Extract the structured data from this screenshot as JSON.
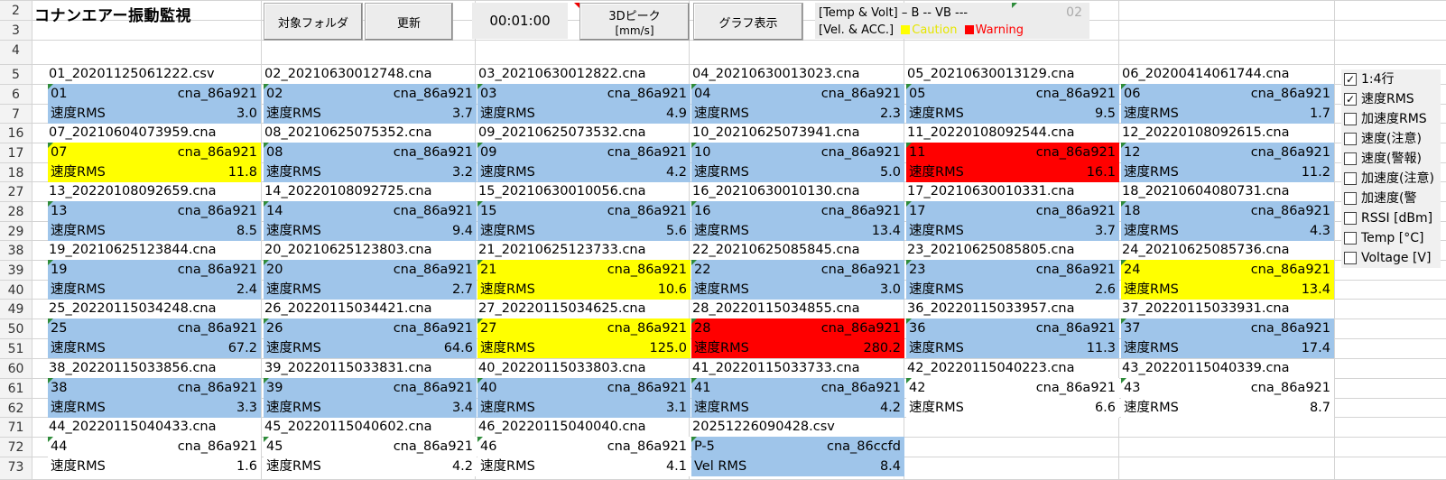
{
  "title": "コナンエアー振動監視",
  "row_numbers": [
    "2",
    "3",
    "4",
    "5",
    "6",
    "7",
    "16",
    "17",
    "18",
    "27",
    "28",
    "29",
    "38",
    "39",
    "40",
    "49",
    "50",
    "51",
    "60",
    "61",
    "62",
    "71",
    "72",
    "73"
  ],
  "toolbar": {
    "folder_button": "対象フォルダ",
    "refresh_button": "更新",
    "time": "00:01:00",
    "peak_button_line1": "3Dピーク",
    "peak_button_line2": "[mm/s]",
    "graph_button": "グラフ表示"
  },
  "legend": {
    "line1": "[Temp & Volt] – B -- VB ---",
    "number": "02",
    "line2_prefix": "[Vel. & ACC.]",
    "caution": "Caution",
    "warning": "Warning"
  },
  "colors": {
    "normal": "#9fc5ea",
    "caution": "#ffff00",
    "warning": "#ff0000",
    "none": "#ffffff"
  },
  "blocks": [
    [
      {
        "file": "01_20201125061222.csv",
        "id": "01",
        "sensor": "cna_86a921",
        "label": "速度RMS",
        "value": "3.0",
        "status": "normal"
      },
      {
        "file": "02_20210630012748.cna",
        "id": "02",
        "sensor": "cna_86a921",
        "label": "速度RMS",
        "value": "3.7",
        "status": "normal"
      },
      {
        "file": "03_20210630012822.cna",
        "id": "03",
        "sensor": "cna_86a921",
        "label": "速度RMS",
        "value": "4.9",
        "status": "normal"
      },
      {
        "file": "04_20210630013023.cna",
        "id": "04",
        "sensor": "cna_86a921",
        "label": "速度RMS",
        "value": "2.3",
        "status": "normal"
      },
      {
        "file": "05_20210630013129.cna",
        "id": "05",
        "sensor": "cna_86a921",
        "label": "速度RMS",
        "value": "9.5",
        "status": "normal"
      },
      {
        "file": "06_20200414061744.cna",
        "id": "06",
        "sensor": "cna_86a921",
        "label": "速度RMS",
        "value": "1.7",
        "status": "normal"
      }
    ],
    [
      {
        "file": "07_20210604073959.cna",
        "id": "07",
        "sensor": "cna_86a921",
        "label": "速度RMS",
        "value": "11.8",
        "status": "caution"
      },
      {
        "file": "08_20210625075352.cna",
        "id": "08",
        "sensor": "cna_86a921",
        "label": "速度RMS",
        "value": "3.2",
        "status": "normal"
      },
      {
        "file": "09_20210625073532.cna",
        "id": "09",
        "sensor": "cna_86a921",
        "label": "速度RMS",
        "value": "4.2",
        "status": "normal"
      },
      {
        "file": "10_20210625073941.cna",
        "id": "10",
        "sensor": "cna_86a921",
        "label": "速度RMS",
        "value": "5.0",
        "status": "normal"
      },
      {
        "file": "11_20220108092544.cna",
        "id": "11",
        "sensor": "cna_86a921",
        "label": "速度RMS",
        "value": "16.1",
        "status": "warning"
      },
      {
        "file": "12_20220108092615.cna",
        "id": "12",
        "sensor": "cna_86a921",
        "label": "速度RMS",
        "value": "11.2",
        "status": "normal"
      }
    ],
    [
      {
        "file": "13_20220108092659.cna",
        "id": "13",
        "sensor": "cna_86a921",
        "label": "速度RMS",
        "value": "8.5",
        "status": "normal"
      },
      {
        "file": "14_20220108092725.cna",
        "id": "14",
        "sensor": "cna_86a921",
        "label": "速度RMS",
        "value": "9.4",
        "status": "normal"
      },
      {
        "file": "15_20210630010056.cna",
        "id": "15",
        "sensor": "cna_86a921",
        "label": "速度RMS",
        "value": "5.6",
        "status": "normal"
      },
      {
        "file": "16_20210630010130.cna",
        "id": "16",
        "sensor": "cna_86a921",
        "label": "速度RMS",
        "value": "13.4",
        "status": "normal"
      },
      {
        "file": "17_20210630010331.cna",
        "id": "17",
        "sensor": "cna_86a921",
        "label": "速度RMS",
        "value": "3.7",
        "status": "normal"
      },
      {
        "file": "18_20210604080731.cna",
        "id": "18",
        "sensor": "cna_86a921",
        "label": "速度RMS",
        "value": "4.3",
        "status": "normal"
      }
    ],
    [
      {
        "file": "19_20210625123844.cna",
        "id": "19",
        "sensor": "cna_86a921",
        "label": "速度RMS",
        "value": "2.4",
        "status": "normal"
      },
      {
        "file": "20_20210625123803.cna",
        "id": "20",
        "sensor": "cna_86a921",
        "label": "速度RMS",
        "value": "2.7",
        "status": "normal"
      },
      {
        "file": "21_20210625123733.cna",
        "id": "21",
        "sensor": "cna_86a921",
        "label": "速度RMS",
        "value": "10.6",
        "status": "caution"
      },
      {
        "file": "22_20210625085845.cna",
        "id": "22",
        "sensor": "cna_86a921",
        "label": "速度RMS",
        "value": "3.0",
        "status": "normal"
      },
      {
        "file": "23_20210625085805.cna",
        "id": "23",
        "sensor": "cna_86a921",
        "label": "速度RMS",
        "value": "2.6",
        "status": "normal"
      },
      {
        "file": "24_20210625085736.cna",
        "id": "24",
        "sensor": "cna_86a921",
        "label": "速度RMS",
        "value": "13.4",
        "status": "caution"
      }
    ],
    [
      {
        "file": "25_20220115034248.cna",
        "id": "25",
        "sensor": "cna_86a921",
        "label": "速度RMS",
        "value": "67.2",
        "status": "normal"
      },
      {
        "file": "26_20220115034421.cna",
        "id": "26",
        "sensor": "cna_86a921",
        "label": "速度RMS",
        "value": "64.6",
        "status": "normal"
      },
      {
        "file": "27_20220115034625.cna",
        "id": "27",
        "sensor": "cna_86a921",
        "label": "速度RMS",
        "value": "125.0",
        "status": "caution"
      },
      {
        "file": "28_20220115034855.cna",
        "id": "28",
        "sensor": "cna_86a921",
        "label": "速度RMS",
        "value": "280.2",
        "status": "warning"
      },
      {
        "file": "36_20220115033957.cna",
        "id": "36",
        "sensor": "cna_86a921",
        "label": "速度RMS",
        "value": "11.3",
        "status": "normal"
      },
      {
        "file": "37_20220115033931.cna",
        "id": "37",
        "sensor": "cna_86a921",
        "label": "速度RMS",
        "value": "17.4",
        "status": "normal"
      }
    ],
    [
      {
        "file": "38_20220115033856.cna",
        "id": "38",
        "sensor": "cna_86a921",
        "label": "速度RMS",
        "value": "3.3",
        "status": "normal"
      },
      {
        "file": "39_20220115033831.cna",
        "id": "39",
        "sensor": "cna_86a921",
        "label": "速度RMS",
        "value": "3.4",
        "status": "normal"
      },
      {
        "file": "40_20220115033803.cna",
        "id": "40",
        "sensor": "cna_86a921",
        "label": "速度RMS",
        "value": "3.1",
        "status": "normal"
      },
      {
        "file": "41_20220115033733.cna",
        "id": "41",
        "sensor": "cna_86a921",
        "label": "速度RMS",
        "value": "4.2",
        "status": "normal"
      },
      {
        "file": "42_20220115040223.cna",
        "id": "42",
        "sensor": "cna_86a921",
        "label": "速度RMS",
        "value": "6.6",
        "status": "none"
      },
      {
        "file": "43_20220115040339.cna",
        "id": "43",
        "sensor": "cna_86a921",
        "label": "速度RMS",
        "value": "8.7",
        "status": "none"
      }
    ],
    [
      {
        "file": "44_20220115040433.cna",
        "id": "44",
        "sensor": "cna_86a921",
        "label": "速度RMS",
        "value": "1.6",
        "status": "none"
      },
      {
        "file": "45_20220115040602.cna",
        "id": "45",
        "sensor": "cna_86a921",
        "label": "速度RMS",
        "value": "4.2",
        "status": "none"
      },
      {
        "file": "46_20220115040040.cna",
        "id": "46",
        "sensor": "cna_86a921",
        "label": "速度RMS",
        "value": "4.1",
        "status": "none"
      },
      {
        "file": "20251226090428.csv",
        "id": "P-5",
        "sensor": "cna_86ccfd",
        "label": "Vel RMS",
        "value": "8.4",
        "status": "normal"
      },
      null,
      null
    ]
  ],
  "checkboxes": [
    {
      "label": "1:4行",
      "checked": true
    },
    {
      "label": "速度RMS",
      "checked": true
    },
    {
      "label": "加速度RMS",
      "checked": false
    },
    {
      "label": "速度(注意)",
      "checked": false
    },
    {
      "label": "速度(警報)",
      "checked": false
    },
    {
      "label": "加速度(注意)",
      "checked": false
    },
    {
      "label": "加速度(警",
      "checked": false
    },
    {
      "label": "RSSI [dBm]",
      "checked": false
    },
    {
      "label": "Temp [°C]",
      "checked": false
    },
    {
      "label": "Voltage [V]",
      "checked": false
    }
  ]
}
